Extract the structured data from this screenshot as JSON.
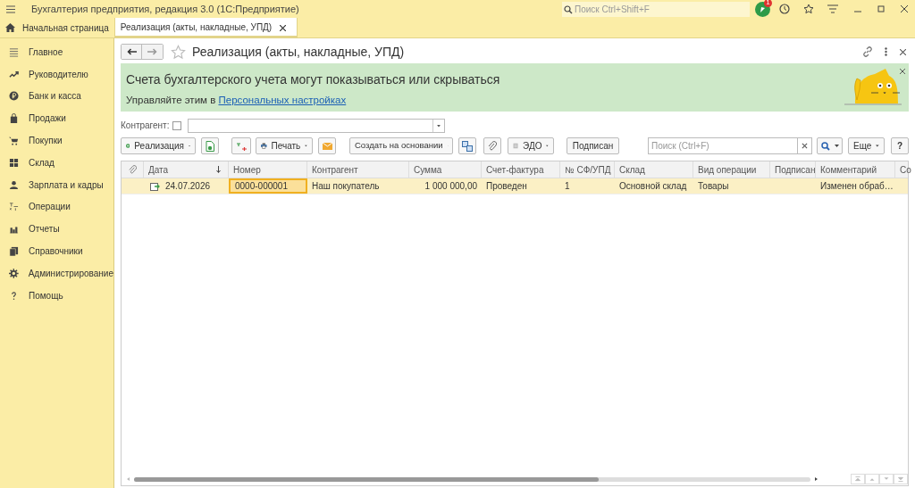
{
  "window": {
    "title": "Бухгалтерия предприятия, редакция 3.0  (1С:Предприятие)",
    "search_placeholder": "Поиск Ctrl+Shift+F",
    "notification_count": "1"
  },
  "tabs": [
    {
      "label": "Начальная страница",
      "selected": false
    },
    {
      "label": "Реализация (акты, накладные, УПД)",
      "selected": true
    }
  ],
  "sidebar": {
    "items": [
      {
        "label": "Главное"
      },
      {
        "label": "Руководителю"
      },
      {
        "label": "Банк и касса"
      },
      {
        "label": "Продажи"
      },
      {
        "label": "Покупки"
      },
      {
        "label": "Склад"
      },
      {
        "label": "Зарплата и кадры"
      },
      {
        "label": "Операции"
      },
      {
        "label": "Отчеты"
      },
      {
        "label": "Справочники"
      },
      {
        "label": "Администрирование"
      },
      {
        "label": "Помощь"
      }
    ]
  },
  "form": {
    "title": "Реализация (акты, накладные, УПД)",
    "banner": {
      "heading": "Счета бухгалтерского учета могут показываться или скрываться",
      "text": "Управляйте этим в ",
      "link": "Персональных настройках"
    },
    "filter": {
      "label": "Контрагент:",
      "checked": false
    },
    "toolbar": {
      "create": "Реализация",
      "print": "Печать",
      "create_based": "Создать на основании",
      "edo": "ЭДО",
      "signed": "Подписан",
      "search_placeholder": "Поиск (Ctrl+F)",
      "more": "Еще",
      "help": "?"
    },
    "table": {
      "columns": [
        "Дата",
        "Номер",
        "Контрагент",
        "Сумма",
        "Счет-фактура",
        "№ СФ/УПД",
        "Склад",
        "Вид операции",
        "Подписан",
        "Комментарий",
        "Со"
      ],
      "rows": [
        {
          "selected": true,
          "cells": [
            {
              "text": "24.07.2026",
              "focused": false
            },
            {
              "text": "0000-000001",
              "focused": true
            },
            {
              "text": "Наш покупатель",
              "focused": false
            },
            {
              "text": "1 000 000,00",
              "focused": false
            },
            {
              "text": "Проведен",
              "focused": false
            },
            {
              "text": "1",
              "focused": false
            },
            {
              "text": "Основной склад",
              "focused": false
            },
            {
              "text": "Товары",
              "focused": false
            },
            null,
            {
              "text": "Изменен обраб…",
              "focused": false
            }
          ]
        }
      ]
    }
  }
}
